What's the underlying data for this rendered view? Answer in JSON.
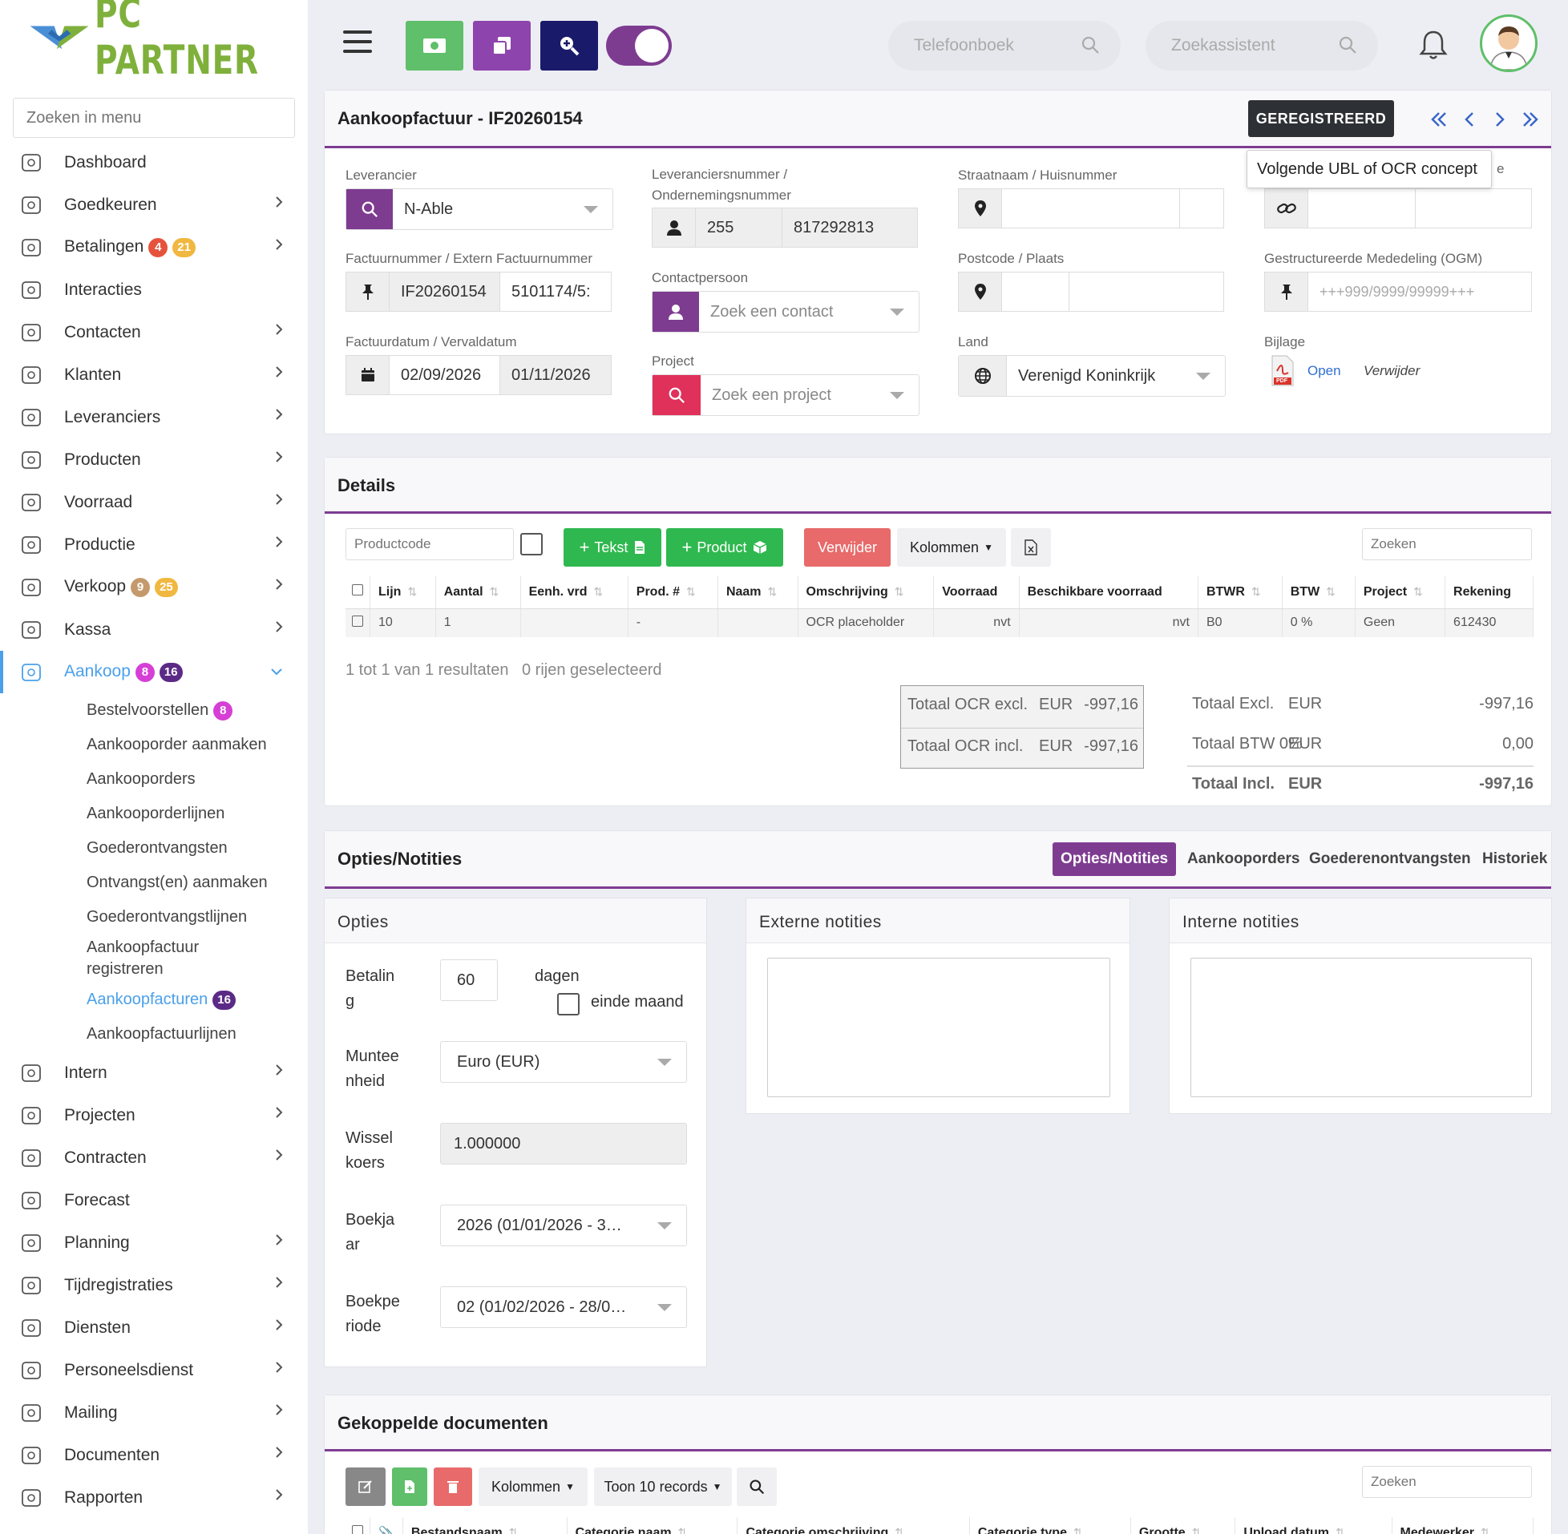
{
  "sidebar": {
    "logo_text": "PC PARTNER",
    "search_placeholder": "Zoeken in menu",
    "items": [
      {
        "label": "Dashboard",
        "icon": "dashboard-icon",
        "chevron": false
      },
      {
        "label": "Goedkeuren",
        "icon": "user-check-icon",
        "chevron": true
      },
      {
        "label": "Betalingen",
        "icon": "card-icon",
        "chevron": true,
        "badges": [
          {
            "text": "4",
            "color": "#e5533c"
          },
          {
            "text": "21",
            "color": "#f0b840"
          }
        ]
      },
      {
        "label": "Interacties",
        "icon": "chat-icon",
        "chevron": false
      },
      {
        "label": "Contacten",
        "icon": "contact-card-icon",
        "chevron": true
      },
      {
        "label": "Klanten",
        "icon": "person-icon",
        "chevron": true
      },
      {
        "label": "Leveranciers",
        "icon": "truck-icon",
        "chevron": true
      },
      {
        "label": "Producten",
        "icon": "box-icon",
        "chevron": true
      },
      {
        "label": "Voorraad",
        "icon": "boxes-icon",
        "chevron": true
      },
      {
        "label": "Productie",
        "icon": "gears-icon",
        "chevron": true
      },
      {
        "label": "Verkoop",
        "icon": "euro-icon",
        "chevron": true,
        "badges": [
          {
            "text": "9",
            "color": "#c49a6c"
          },
          {
            "text": "25",
            "color": "#f0b840"
          }
        ]
      },
      {
        "label": "Kassa",
        "icon": "basket-icon",
        "chevron": true
      },
      {
        "label": "Aankoop",
        "icon": "cart-icon",
        "chevron": true,
        "active": true,
        "badges": [
          {
            "text": "8",
            "color": "#d63fd6"
          },
          {
            "text": "16",
            "color": "#5b2a86"
          }
        ]
      }
    ],
    "aankoop_sub": [
      {
        "label": "Bestelvoorstellen",
        "badge": "8",
        "color": "#d63fd6"
      },
      {
        "label": "Aankooporder aanmaken"
      },
      {
        "label": "Aankooporders"
      },
      {
        "label": "Aankooporderlijnen"
      },
      {
        "label": "Goederontvangsten"
      },
      {
        "label": "Ontvangst(en) aanmaken"
      },
      {
        "label": "Goederontvangstlijnen"
      },
      {
        "label": "Aankoopfactuur registreren",
        "two_line": true
      },
      {
        "label": "Aankoopfacturen",
        "badge": "16",
        "color": "#5b2a86",
        "active": true
      },
      {
        "label": "Aankoopfactuurlijnen"
      }
    ],
    "items_bottom": [
      {
        "label": "Intern",
        "icon": "people-icon",
        "chevron": true
      },
      {
        "label": "Projecten",
        "icon": "project-icon",
        "chevron": true
      },
      {
        "label": "Contracten",
        "icon": "contract-icon",
        "chevron": true
      },
      {
        "label": "Forecast",
        "icon": "forecast-icon",
        "chevron": false
      },
      {
        "label": "Planning",
        "icon": "calendar-icon",
        "chevron": true
      },
      {
        "label": "Tijdregistraties",
        "icon": "timer-icon",
        "chevron": true
      },
      {
        "label": "Diensten",
        "icon": "refresh-icon",
        "chevron": true
      },
      {
        "label": "Personeelsdienst",
        "icon": "staff-icon",
        "chevron": true
      },
      {
        "label": "Mailing",
        "icon": "send-icon",
        "chevron": true
      },
      {
        "label": "Documenten",
        "icon": "folder-icon",
        "chevron": true
      },
      {
        "label": "Rapporten",
        "icon": "chart-icon",
        "chevron": true
      }
    ]
  },
  "topbar": {
    "phonebook_placeholder": "Telefoonboek",
    "assistant_placeholder": "Zoekassistent"
  },
  "invoice": {
    "title": "Aankoopfactuur - IF20260154",
    "status": "GEREGISTREERD",
    "tooltip": "Volgende UBL of OCR concept",
    "tooltip_clip": "e",
    "labels": {
      "supplier": "Leverancier",
      "supplier_no": "Leveranciersnummer /",
      "supplier_no2": "Ondernemingsnummer",
      "street": "Straatnaam / Huisnummer",
      "invoice_no": "Factuurnummer / Extern Factuurnummer",
      "contact": "Contactpersoon",
      "postcode": "Postcode / Plaats",
      "ogm": "Gestructureerde Mededeling (OGM)",
      "dates": "Factuurdatum / Vervaldatum",
      "project": "Project",
      "country": "Land",
      "attachment": "Bijlage"
    },
    "supplier": "N-Able",
    "supplier_number": "255",
    "company_number": "817292813",
    "invoice_number": "IF20260154",
    "external_number": "5101174/5:",
    "contact_placeholder": "Zoek een contact",
    "ogm_placeholder": "+++999/9999/99999+++",
    "invoice_date": "02/09/2026",
    "due_date": "01/11/2026",
    "project_placeholder": "Zoek een project",
    "country": "Verenigd Koninkrijk",
    "attachment_open": "Open",
    "attachment_remove": "Verwijder",
    "attachment_icon_label": "PDF"
  },
  "details": {
    "title": "Details",
    "productcode_placeholder": "Productcode",
    "btn_text": "Tekst",
    "btn_product": "Product",
    "btn_delete": "Verwijder",
    "btn_columns": "Kolommen",
    "search_placeholder": "Zoeken",
    "columns": [
      "Lijn",
      "Aantal",
      "Eenh. vrd",
      "Prod. #",
      "Naam",
      "Omschrijving",
      "Voorraad",
      "Beschikbare voorraad",
      "BTWR",
      "BTW",
      "Project",
      "Rekening"
    ],
    "rows": [
      [
        "10",
        "1",
        "",
        "-",
        "",
        "OCR placeholder",
        "nvt",
        "nvt",
        "B0",
        "0 %",
        "Geen",
        "612430"
      ]
    ],
    "result_text": "1 tot 1 van 1 resultaten",
    "selected_text": "0 rijen geselecteerd",
    "totals": {
      "ocr_excl_label": "Totaal OCR excl.",
      "ocr_excl_cur": "EUR",
      "ocr_excl_val": "-997,16",
      "ocr_incl_label": "Totaal OCR incl.",
      "ocr_incl_cur": "EUR",
      "ocr_incl_val": "-997,16",
      "excl_label": "Totaal Excl.",
      "excl_cur": "EUR",
      "excl_val": "-997,16",
      "btw_label": "Totaal BTW 0%",
      "btw_cur": "EUR",
      "btw_val": "0,00",
      "incl_label": "Totaal Incl.",
      "incl_cur": "EUR",
      "incl_val": "-997,16"
    }
  },
  "options": {
    "title": "Opties/Notities",
    "tabs": [
      "Opties/Notities",
      "Aankooporders",
      "Goederenontvangsten",
      "Historiek"
    ],
    "opties_title": "Opties",
    "external_title": "Externe notities",
    "internal_title": "Interne notities",
    "betaling_label": [
      "Betalin",
      "g"
    ],
    "betaling_value": "60",
    "dagen": "dagen",
    "einde_maand": "einde maand",
    "munt_label": [
      "Muntee",
      "nheid"
    ],
    "munt_value": "Euro (EUR)",
    "wissel_label": [
      "Wissel",
      "koers"
    ],
    "wissel_value": "1.000000",
    "boekjaar_label": [
      "Boekja",
      "ar"
    ],
    "boekjaar_value": "2026 (01/01/2026 - 3…",
    "periode_label": [
      "Boekpe",
      "riode"
    ],
    "periode_value": "02 (01/02/2026 - 28/0…"
  },
  "documents": {
    "title": "Gekoppelde documenten",
    "btn_columns": "Kolommen",
    "btn_show": "Toon 10 records",
    "search_placeholder": "Zoeken",
    "columns": [
      "Bestandsnaam",
      "Categorie naam",
      "Categorie omschrijving",
      "Categorie type",
      "Grootte",
      "Upload datum",
      "Medewerker"
    ]
  }
}
